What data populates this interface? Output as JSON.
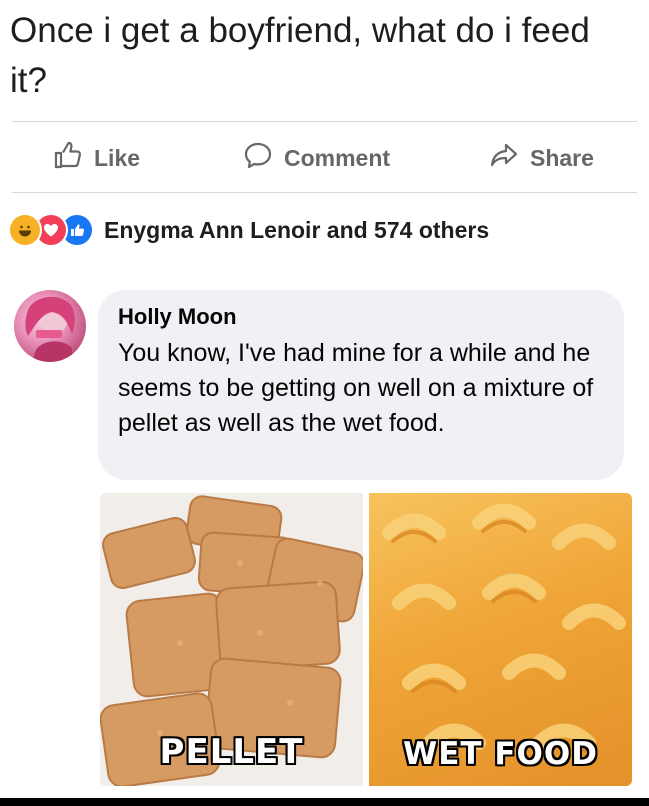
{
  "post": {
    "text": "Once i get a boyfriend, what do i feed it?"
  },
  "actions": {
    "like_label": "Like",
    "comment_label": "Comment",
    "share_label": "Share"
  },
  "reactions": {
    "icons": [
      "haha-reaction-icon",
      "love-reaction-icon",
      "like-reaction-icon"
    ],
    "summary": "Enygma Ann Lenoir and 574 others"
  },
  "comment": {
    "author": "Holly Moon",
    "text": "You know, I've had mine for a while and he seems to be getting on well on a mixture of pellet as well as the wet food."
  },
  "meme": {
    "left_caption": "PELLET",
    "right_caption": "WET FOOD"
  },
  "colors": {
    "action_gray": "#65676b",
    "bubble_bg": "#eff1f4",
    "like_blue": "#1877f2",
    "love_red": "#f33e58",
    "haha_yellow": "#f7b125"
  }
}
